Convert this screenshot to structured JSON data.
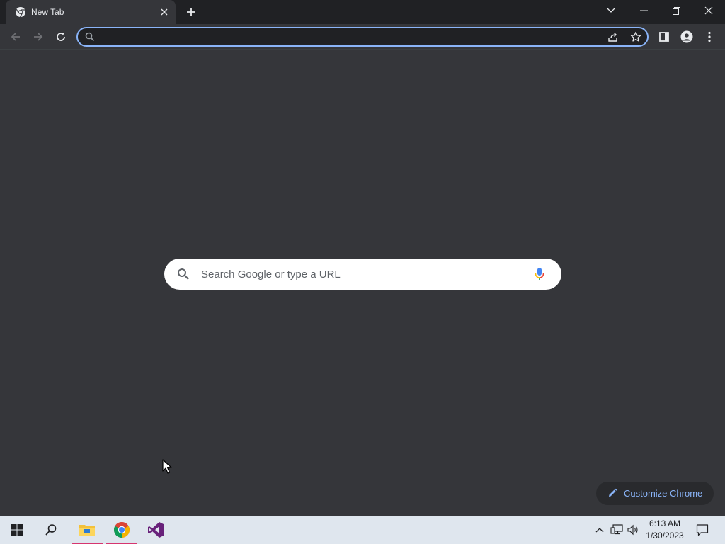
{
  "browser": {
    "tab": {
      "title": "New Tab"
    },
    "omnibox": {
      "value": "",
      "placeholder": ""
    }
  },
  "ntp": {
    "search_placeholder": "Search Google or type a URL",
    "customize_label": "Customize Chrome"
  },
  "taskbar": {
    "apps": [
      "start-icon",
      "search-icon",
      "file-explorer-icon",
      "chrome-icon",
      "visual-studio-icon"
    ],
    "clock": {
      "time": "6:13 AM",
      "date": "1/30/2023"
    }
  },
  "colors": {
    "page_bg": "#35363a",
    "tabstrip_bg": "#202124",
    "accent": "#8ab4f8",
    "taskbar_bg": "#dfe6ee",
    "taskbar_active": "#d6356f"
  }
}
